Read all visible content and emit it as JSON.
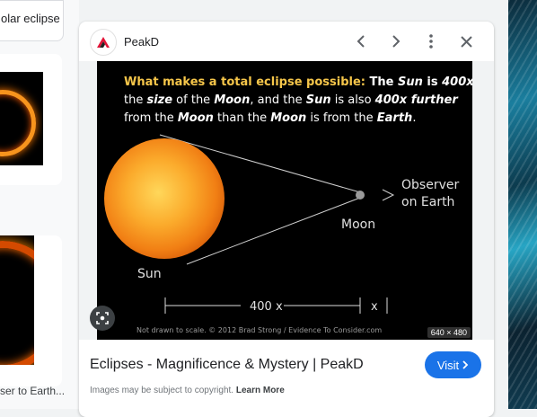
{
  "left": {
    "chip_text": "olar eclipse",
    "caption": "ser to Earth..."
  },
  "panel": {
    "site": "PeakD",
    "title": "Eclipses - Magnificence & Mystery | PeakD",
    "visit_label": "Visit",
    "copyright_text": "Images may be subject to copyright.",
    "learn_more": "Learn More",
    "image_size": "640 × 480"
  },
  "image": {
    "headline_lead": "What makes a total eclipse possible:",
    "headline_rest_1": " The ",
    "sun_word": "Sun",
    "headline_rest_2": " is ",
    "x400": "400x",
    "line2_a": "the ",
    "size_word": "size",
    "line2_b": " of the ",
    "moon_word": "Moon",
    "line2_c": ", and the ",
    "line2_d": " is also ",
    "further": "400x further",
    "line3_a": "from the ",
    "line3_b": " than the ",
    "line3_c": " is from the ",
    "earth_word": "Earth",
    "observer": "Observer",
    "on_earth": "on Earth",
    "moon_label": "Moon",
    "sun_label": "Sun",
    "dist_400x": "400 x",
    "dist_x": "x",
    "footer": "Not drawn to scale.  © 2012 Brad Strong / Evidence To Consider.com"
  },
  "colors": {
    "accent": "#1a73e8",
    "headline_yellow": "#f6c64a",
    "sun_orange": "#f39a1e"
  },
  "icons": [
    "chevron-left-icon",
    "chevron-right-icon",
    "more-vert-icon",
    "close-icon",
    "lens-icon",
    "chevron-right-small-icon"
  ]
}
